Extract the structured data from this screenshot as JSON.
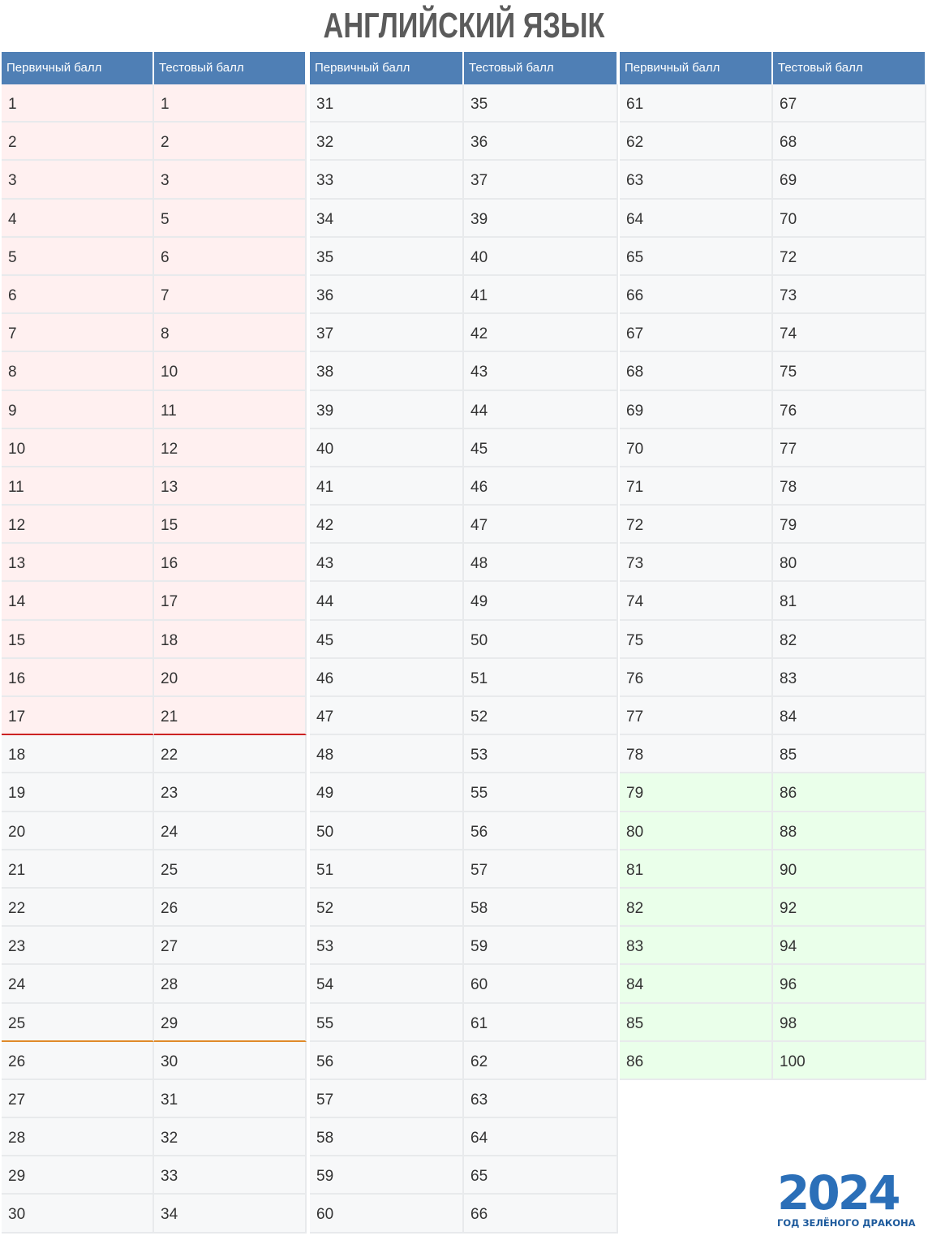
{
  "title": "АНГЛИЙСКИЙ ЯЗЫК",
  "headers": {
    "primary": "Первичный балл",
    "test": "Тестовый балл"
  },
  "tables": [
    {
      "rows": [
        [
          "1",
          "1"
        ],
        [
          "2",
          "2"
        ],
        [
          "3",
          "3"
        ],
        [
          "4",
          "5"
        ],
        [
          "5",
          "6"
        ],
        [
          "6",
          "7"
        ],
        [
          "7",
          "8"
        ],
        [
          "8",
          "10"
        ],
        [
          "9",
          "11"
        ],
        [
          "10",
          "12"
        ],
        [
          "11",
          "13"
        ],
        [
          "12",
          "15"
        ],
        [
          "13",
          "16"
        ],
        [
          "14",
          "17"
        ],
        [
          "15",
          "18"
        ],
        [
          "16",
          "20"
        ],
        [
          "17",
          "21"
        ],
        [
          "18",
          "22"
        ],
        [
          "19",
          "23"
        ],
        [
          "20",
          "24"
        ],
        [
          "21",
          "25"
        ],
        [
          "22",
          "26"
        ],
        [
          "23",
          "27"
        ],
        [
          "24",
          "28"
        ],
        [
          "25",
          "29"
        ],
        [
          "26",
          "30"
        ],
        [
          "27",
          "31"
        ],
        [
          "28",
          "32"
        ],
        [
          "29",
          "33"
        ],
        [
          "30",
          "34"
        ]
      ]
    },
    {
      "rows": [
        [
          "31",
          "35"
        ],
        [
          "32",
          "36"
        ],
        [
          "33",
          "37"
        ],
        [
          "34",
          "39"
        ],
        [
          "35",
          "40"
        ],
        [
          "36",
          "41"
        ],
        [
          "37",
          "42"
        ],
        [
          "38",
          "43"
        ],
        [
          "39",
          "44"
        ],
        [
          "40",
          "45"
        ],
        [
          "41",
          "46"
        ],
        [
          "42",
          "47"
        ],
        [
          "43",
          "48"
        ],
        [
          "44",
          "49"
        ],
        [
          "45",
          "50"
        ],
        [
          "46",
          "51"
        ],
        [
          "47",
          "52"
        ],
        [
          "48",
          "53"
        ],
        [
          "49",
          "55"
        ],
        [
          "50",
          "56"
        ],
        [
          "51",
          "57"
        ],
        [
          "52",
          "58"
        ],
        [
          "53",
          "59"
        ],
        [
          "54",
          "60"
        ],
        [
          "55",
          "61"
        ],
        [
          "56",
          "62"
        ],
        [
          "57",
          "63"
        ],
        [
          "58",
          "64"
        ],
        [
          "59",
          "65"
        ],
        [
          "60",
          "66"
        ]
      ]
    },
    {
      "rows": [
        [
          "61",
          "67"
        ],
        [
          "62",
          "68"
        ],
        [
          "63",
          "69"
        ],
        [
          "64",
          "70"
        ],
        [
          "65",
          "72"
        ],
        [
          "66",
          "73"
        ],
        [
          "67",
          "74"
        ],
        [
          "68",
          "75"
        ],
        [
          "69",
          "76"
        ],
        [
          "70",
          "77"
        ],
        [
          "71",
          "78"
        ],
        [
          "72",
          "79"
        ],
        [
          "73",
          "80"
        ],
        [
          "74",
          "81"
        ],
        [
          "75",
          "82"
        ],
        [
          "76",
          "83"
        ],
        [
          "77",
          "84"
        ],
        [
          "78",
          "85"
        ],
        [
          "79",
          "86"
        ],
        [
          "80",
          "88"
        ],
        [
          "81",
          "90"
        ],
        [
          "82",
          "92"
        ],
        [
          "83",
          "94"
        ],
        [
          "84",
          "96"
        ],
        [
          "85",
          "98"
        ],
        [
          "86",
          "100"
        ]
      ]
    }
  ],
  "colors": {
    "header": "#4f7fb5",
    "fail_zone": "#fff0f0",
    "top_zone": "#eaffea",
    "threshold_min": "#cc2222",
    "threshold_university": "#e08a2a"
  },
  "logo": {
    "year": "2024",
    "subtitle": "ГОД ЗЕЛЁНОГО ДРАКОНА"
  }
}
